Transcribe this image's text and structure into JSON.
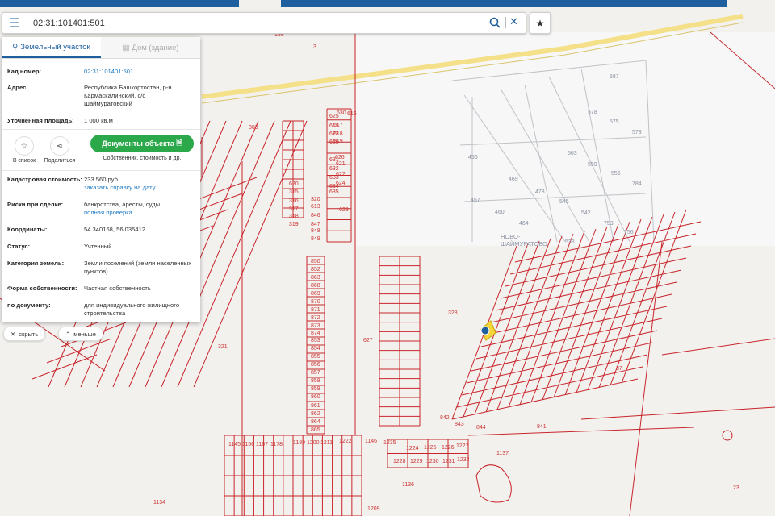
{
  "search": {
    "value": "02:31:101401:501",
    "placeholder": ""
  },
  "tabs": [
    {
      "label": "Земельный участок"
    },
    {
      "label": "Дом (здание)"
    }
  ],
  "info": {
    "cad_label": "Кад.номер:",
    "cad_value": "02:31:101401:501",
    "addr_label": "Адрес:",
    "addr_value": "Республика Башкортостан, р-н Кармаскалинский, с/с Шаймуратовский",
    "area_label": "Уточненная площадь:",
    "area_value": "1 000 кв.м",
    "cost_label": "Кадастровая стоимость:",
    "cost_value": "233 560 руб.",
    "cost_link": "заказать справку на дату",
    "risk_label": "Риски при сделке:",
    "risk_value": "банкротства, аресты, суды",
    "risk_link": "полная проверка",
    "coord_label": "Координаты:",
    "coord_value": "54.340168, 56.035412",
    "status_label": "Статус:",
    "status_value": "Учтенный",
    "cat_label": "Категория земель:",
    "cat_value": "Земли поселений (земли населенных пунктов)",
    "own_label": "Форма собственности:",
    "own_value": "Частная собственность",
    "doc_label": "по документу:",
    "doc_value": "для индивидуального жилищного строительства"
  },
  "actions": {
    "list_label": "В список",
    "share_label": "Поделиться",
    "doc_button": "Документы объекта",
    "doc_sub": "Собственник, стоимость и др."
  },
  "pills": {
    "hide": "скрыть",
    "less": "меньше"
  },
  "map": {
    "village_label_1": "НОВО-",
    "village_label_2": "ШАЙМУРАТОВО",
    "numbers": [
      "3",
      "158",
      "303",
      "328",
      "321",
      "37",
      "23",
      "628",
      "627",
      "1134",
      "1136",
      "1137",
      "587",
      "578",
      "575",
      "573",
      "563",
      "559",
      "556",
      "784",
      "469",
      "473",
      "545",
      "542",
      "753",
      "756",
      "464",
      "460",
      "457",
      "456",
      "538",
      "842",
      "843",
      "844",
      "841",
      "1145",
      "1156",
      "1167",
      "1178",
      "1189",
      "1200",
      "1211",
      "1222",
      "1146",
      "1235",
      "1224",
      "1225",
      "1226",
      "1227",
      "1228",
      "1229",
      "1230",
      "1231",
      "1232",
      "1209",
      "631",
      "632",
      "633",
      "634",
      "635",
      "626",
      "621",
      "622",
      "624",
      "625",
      "612",
      "623",
      "629",
      "630",
      "616",
      "617",
      "618",
      "619",
      "620",
      "315",
      "316",
      "317",
      "318",
      "319",
      "320",
      "613",
      "846",
      "847",
      "848",
      "849",
      "850",
      "852",
      "863",
      "868",
      "869",
      "870",
      "871",
      "872",
      "873",
      "874",
      "853",
      "854",
      "855",
      "856",
      "857",
      "858",
      "859",
      "860",
      "861",
      "862",
      "864",
      "865",
      "866",
      "867"
    ],
    "accent_red": "#c8252b",
    "highlight": "#f4d63b",
    "marker": "#1f5f9e"
  }
}
